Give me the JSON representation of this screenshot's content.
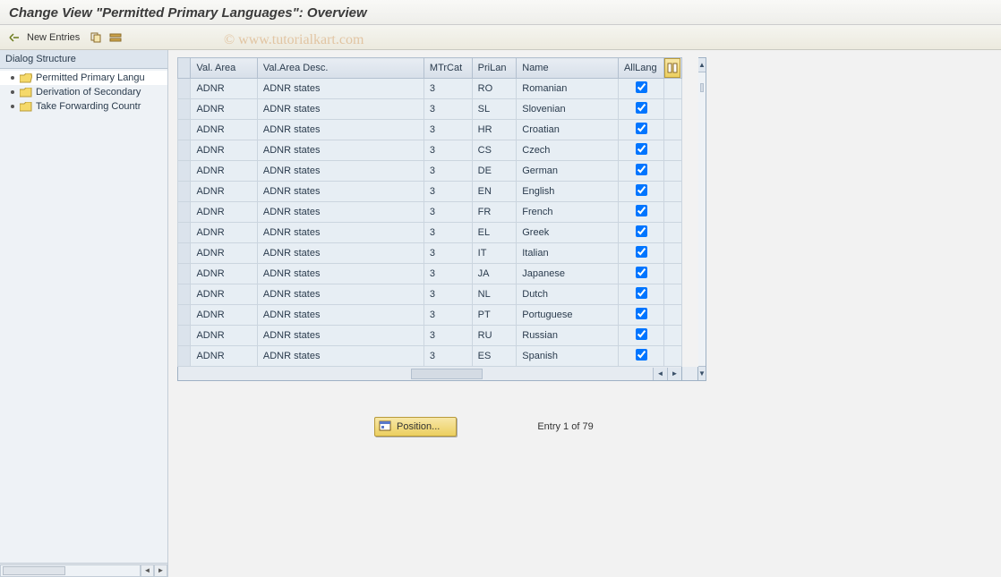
{
  "title": "Change View \"Permitted Primary Languages\": Overview",
  "watermark": "© www.tutorialkart.com",
  "toolbar": {
    "new_entries": "New Entries"
  },
  "sidebar": {
    "header": "Dialog Structure",
    "items": [
      {
        "label": "Permitted Primary Langu",
        "selected": true,
        "open": true
      },
      {
        "label": "Derivation of Secondary",
        "selected": false,
        "open": false
      },
      {
        "label": "Take Forwarding Countr",
        "selected": false,
        "open": false
      }
    ]
  },
  "grid": {
    "columns": {
      "val_area": "Val. Area",
      "val_area_desc": "Val.Area Desc.",
      "mtrcat": "MTrCat",
      "prilan": "PriLan",
      "name": "Name",
      "alllang": "AllLang"
    },
    "rows": [
      {
        "val_area": "ADNR",
        "desc": "ADNR states",
        "mtrcat": "3",
        "prilan": "RO",
        "name": "Romanian",
        "all": true
      },
      {
        "val_area": "ADNR",
        "desc": "ADNR states",
        "mtrcat": "3",
        "prilan": "SL",
        "name": "Slovenian",
        "all": true
      },
      {
        "val_area": "ADNR",
        "desc": "ADNR states",
        "mtrcat": "3",
        "prilan": "HR",
        "name": "Croatian",
        "all": true
      },
      {
        "val_area": "ADNR",
        "desc": "ADNR states",
        "mtrcat": "3",
        "prilan": "CS",
        "name": "Czech",
        "all": true
      },
      {
        "val_area": "ADNR",
        "desc": "ADNR states",
        "mtrcat": "3",
        "prilan": "DE",
        "name": "German",
        "all": true
      },
      {
        "val_area": "ADNR",
        "desc": "ADNR states",
        "mtrcat": "3",
        "prilan": "EN",
        "name": "English",
        "all": true
      },
      {
        "val_area": "ADNR",
        "desc": "ADNR states",
        "mtrcat": "3",
        "prilan": "FR",
        "name": "French",
        "all": true
      },
      {
        "val_area": "ADNR",
        "desc": "ADNR states",
        "mtrcat": "3",
        "prilan": "EL",
        "name": "Greek",
        "all": true
      },
      {
        "val_area": "ADNR",
        "desc": "ADNR states",
        "mtrcat": "3",
        "prilan": "IT",
        "name": "Italian",
        "all": true
      },
      {
        "val_area": "ADNR",
        "desc": "ADNR states",
        "mtrcat": "3",
        "prilan": "JA",
        "name": "Japanese",
        "all": true
      },
      {
        "val_area": "ADNR",
        "desc": "ADNR states",
        "mtrcat": "3",
        "prilan": "NL",
        "name": "Dutch",
        "all": true
      },
      {
        "val_area": "ADNR",
        "desc": "ADNR states",
        "mtrcat": "3",
        "prilan": "PT",
        "name": "Portuguese",
        "all": true
      },
      {
        "val_area": "ADNR",
        "desc": "ADNR states",
        "mtrcat": "3",
        "prilan": "RU",
        "name": "Russian",
        "all": true
      },
      {
        "val_area": "ADNR",
        "desc": "ADNR states",
        "mtrcat": "3",
        "prilan": "ES",
        "name": "Spanish",
        "all": true
      }
    ]
  },
  "footer": {
    "position_label": "Position...",
    "entry_text": "Entry 1 of 79"
  }
}
